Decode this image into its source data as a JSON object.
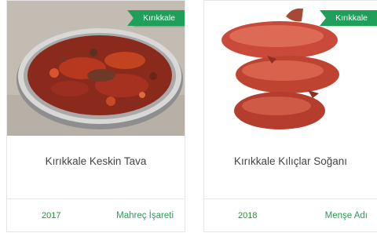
{
  "cards": [
    {
      "location_tag": "Kırıkkale",
      "title": "Kırıkkale Keskin Tava",
      "year": "2017",
      "type": "Mahreç İşareti"
    },
    {
      "location_tag": "Kırıkkale",
      "title": "Kırıkkale Kılıçlar Soğanı",
      "year": "2018",
      "type": "Menşe Adı"
    }
  ],
  "colors": {
    "tag_green": "#1f9f5a",
    "footer_text": "#2c9a56"
  }
}
